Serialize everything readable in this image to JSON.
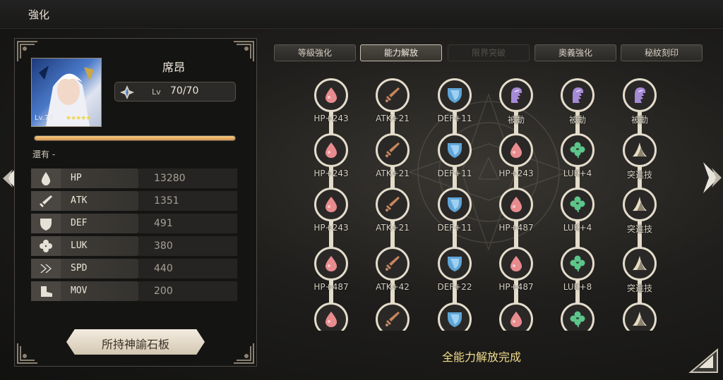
{
  "header": {
    "title": "強化"
  },
  "hero": {
    "name": "席昂",
    "level_label": "Lv",
    "level": "70/70",
    "portrait_level": "Lv.70",
    "stars": "★★★★★",
    "xp_fill": 1.0,
    "remaining_text": "還有 -"
  },
  "stats": [
    {
      "name": "HP",
      "value": "13280",
      "icon": "drop-icon"
    },
    {
      "name": "ATK",
      "value": "1351",
      "icon": "sword-icon"
    },
    {
      "name": "DEF",
      "value": "491",
      "icon": "shield-icon"
    },
    {
      "name": "LUK",
      "value": "380",
      "icon": "clover-icon"
    },
    {
      "name": "SPD",
      "value": "440",
      "icon": "chevrons-icon"
    },
    {
      "name": "MOV",
      "value": "200",
      "icon": "boot-icon"
    }
  ],
  "stone_button": "所持神諭石板",
  "tabs": [
    {
      "label": "等級強化",
      "state": "normal"
    },
    {
      "label": "能力解放",
      "state": "active"
    },
    {
      "label": "限界突破",
      "state": "disabled"
    },
    {
      "label": "奧義強化",
      "state": "normal"
    },
    {
      "label": "秘紋刻印",
      "state": "normal"
    }
  ],
  "grid": {
    "rows": [
      [
        {
          "type": "hp",
          "label": "HP+243"
        },
        {
          "type": "atk",
          "label": "ATK+21"
        },
        {
          "type": "def",
          "label": "DEF+11"
        },
        {
          "type": "passive",
          "label": "被動"
        },
        {
          "type": "passive",
          "label": "被動"
        },
        {
          "type": "passive",
          "label": "被動"
        }
      ],
      [
        {
          "type": "hp",
          "label": "HP+243"
        },
        {
          "type": "atk",
          "label": "ATK+21"
        },
        {
          "type": "def",
          "label": "DEF+11"
        },
        {
          "type": "hp",
          "label": "HP+243"
        },
        {
          "type": "luk",
          "label": "LUK+4"
        },
        {
          "type": "charge",
          "label": "突進技"
        }
      ],
      [
        {
          "type": "hp",
          "label": "HP+243"
        },
        {
          "type": "atk",
          "label": "ATK+21"
        },
        {
          "type": "def",
          "label": "DEF+11"
        },
        {
          "type": "hp",
          "label": "HP+487"
        },
        {
          "type": "luk",
          "label": "LUK+4"
        },
        {
          "type": "charge",
          "label": "突進技"
        }
      ],
      [
        {
          "type": "hp",
          "label": "HP+487"
        },
        {
          "type": "atk",
          "label": "ATK+42"
        },
        {
          "type": "def",
          "label": "DEF+22"
        },
        {
          "type": "hp",
          "label": "HP+487"
        },
        {
          "type": "luk",
          "label": "LUK+8"
        },
        {
          "type": "charge",
          "label": "突進技"
        }
      ],
      [
        {
          "type": "hp",
          "label": ""
        },
        {
          "type": "atk",
          "label": ""
        },
        {
          "type": "def",
          "label": ""
        },
        {
          "type": "hp",
          "label": ""
        },
        {
          "type": "luk",
          "label": ""
        },
        {
          "type": "charge",
          "label": ""
        }
      ]
    ]
  },
  "complete_text": "全能力解放完成",
  "colors": {
    "hp": "#e88b8f",
    "atk": "#c8865e",
    "def": "#5fa6d8",
    "passive": "#a58ad6",
    "luk": "#5cc68a",
    "charge": "#e7dcc4",
    "xp": "#e4ac63",
    "complete": "#f2dc8b"
  }
}
